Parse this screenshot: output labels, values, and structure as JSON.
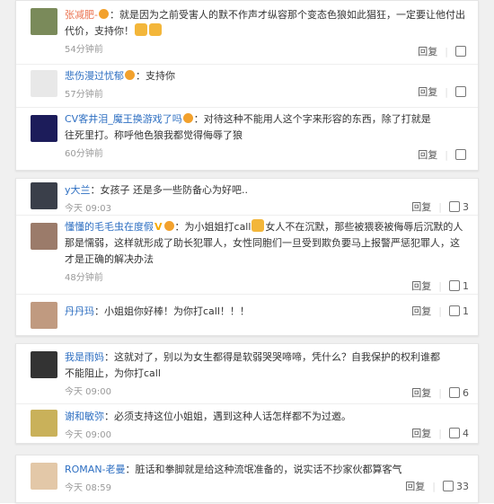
{
  "comments_group1": [
    {
      "user": "张减肥-",
      "text": "：就是因为之前受害人的默不作声才纵容那个变态色狼如此猖狂，一定要让他付出代价，支持你！",
      "time": "54分钟前",
      "reply": "回复",
      "like": "",
      "avatar_color": "#7a8a5a"
    },
    {
      "user": "悲伤漫过忧郁",
      "text": "：支持你",
      "time": "57分钟前",
      "reply": "回复",
      "like": "",
      "avatar_color": "#e8e8e8"
    },
    {
      "user": "CV客井泪_魔王换游戏了吗",
      "text": "：对待这种不能用人这个字来形容的东西，除了打就是往死里打。称呼他色狼我都觉得侮辱了狼",
      "time": "60分钟前",
      "reply": "回复",
      "like": "",
      "avatar_color": "#1c1c5a"
    }
  ],
  "comments_group2": [
    {
      "user": "y大兰",
      "text": "：女孩子 还是多一些防备心为好吧..",
      "time": "今天 09:03",
      "reply": "回复",
      "like": "3",
      "avatar_color": "#3a3f4a"
    },
    {
      "user": "懂懂的毛毛虫在度假",
      "text": "：为小姐姐打call",
      "text2": "女人不在沉默，那些被猥亵被侮辱后沉默的人那是懦弱，这样就形成了助长犯罪人，女性同胞们一旦受到欺负要马上报警严惩犯罪人，这才是正确的解决办法",
      "time": "48分钟前",
      "reply": "回复",
      "like": "1",
      "avatar_color": "#9b7b6a"
    },
    {
      "user": "丹丹玛",
      "text": "：小姐姐你好棒！为你打call！！！",
      "time": "",
      "reply": "回复",
      "like": "1",
      "avatar_color": "#c09a80"
    }
  ],
  "comments_group3": [
    {
      "user": "我是雨妈",
      "text": "：这就对了，别以为女生都得是软弱哭哭啼啼，凭什么？自我保护的权利谁都不能阻止，为你打call",
      "time": "今天 09:00",
      "reply": "回复",
      "like": "6",
      "avatar_color": "#333333"
    },
    {
      "user": "谢和敏弥",
      "text": "：必须支持这位小姐姐，遇到这种人话怎样都不为过邀。",
      "time": "今天 09:00",
      "reply": "回复",
      "like": "4",
      "avatar_color": "#c9b15a"
    }
  ],
  "comments_group4": [
    {
      "user": "ROMAN-老曼",
      "text": "：脏话和拳脚就是给这种流氓准备的，说实话不抄家伙都算客气",
      "time": "今天 08:59",
      "reply": "回复",
      "like": "33",
      "avatar_color": "#e3c8a8"
    }
  ]
}
